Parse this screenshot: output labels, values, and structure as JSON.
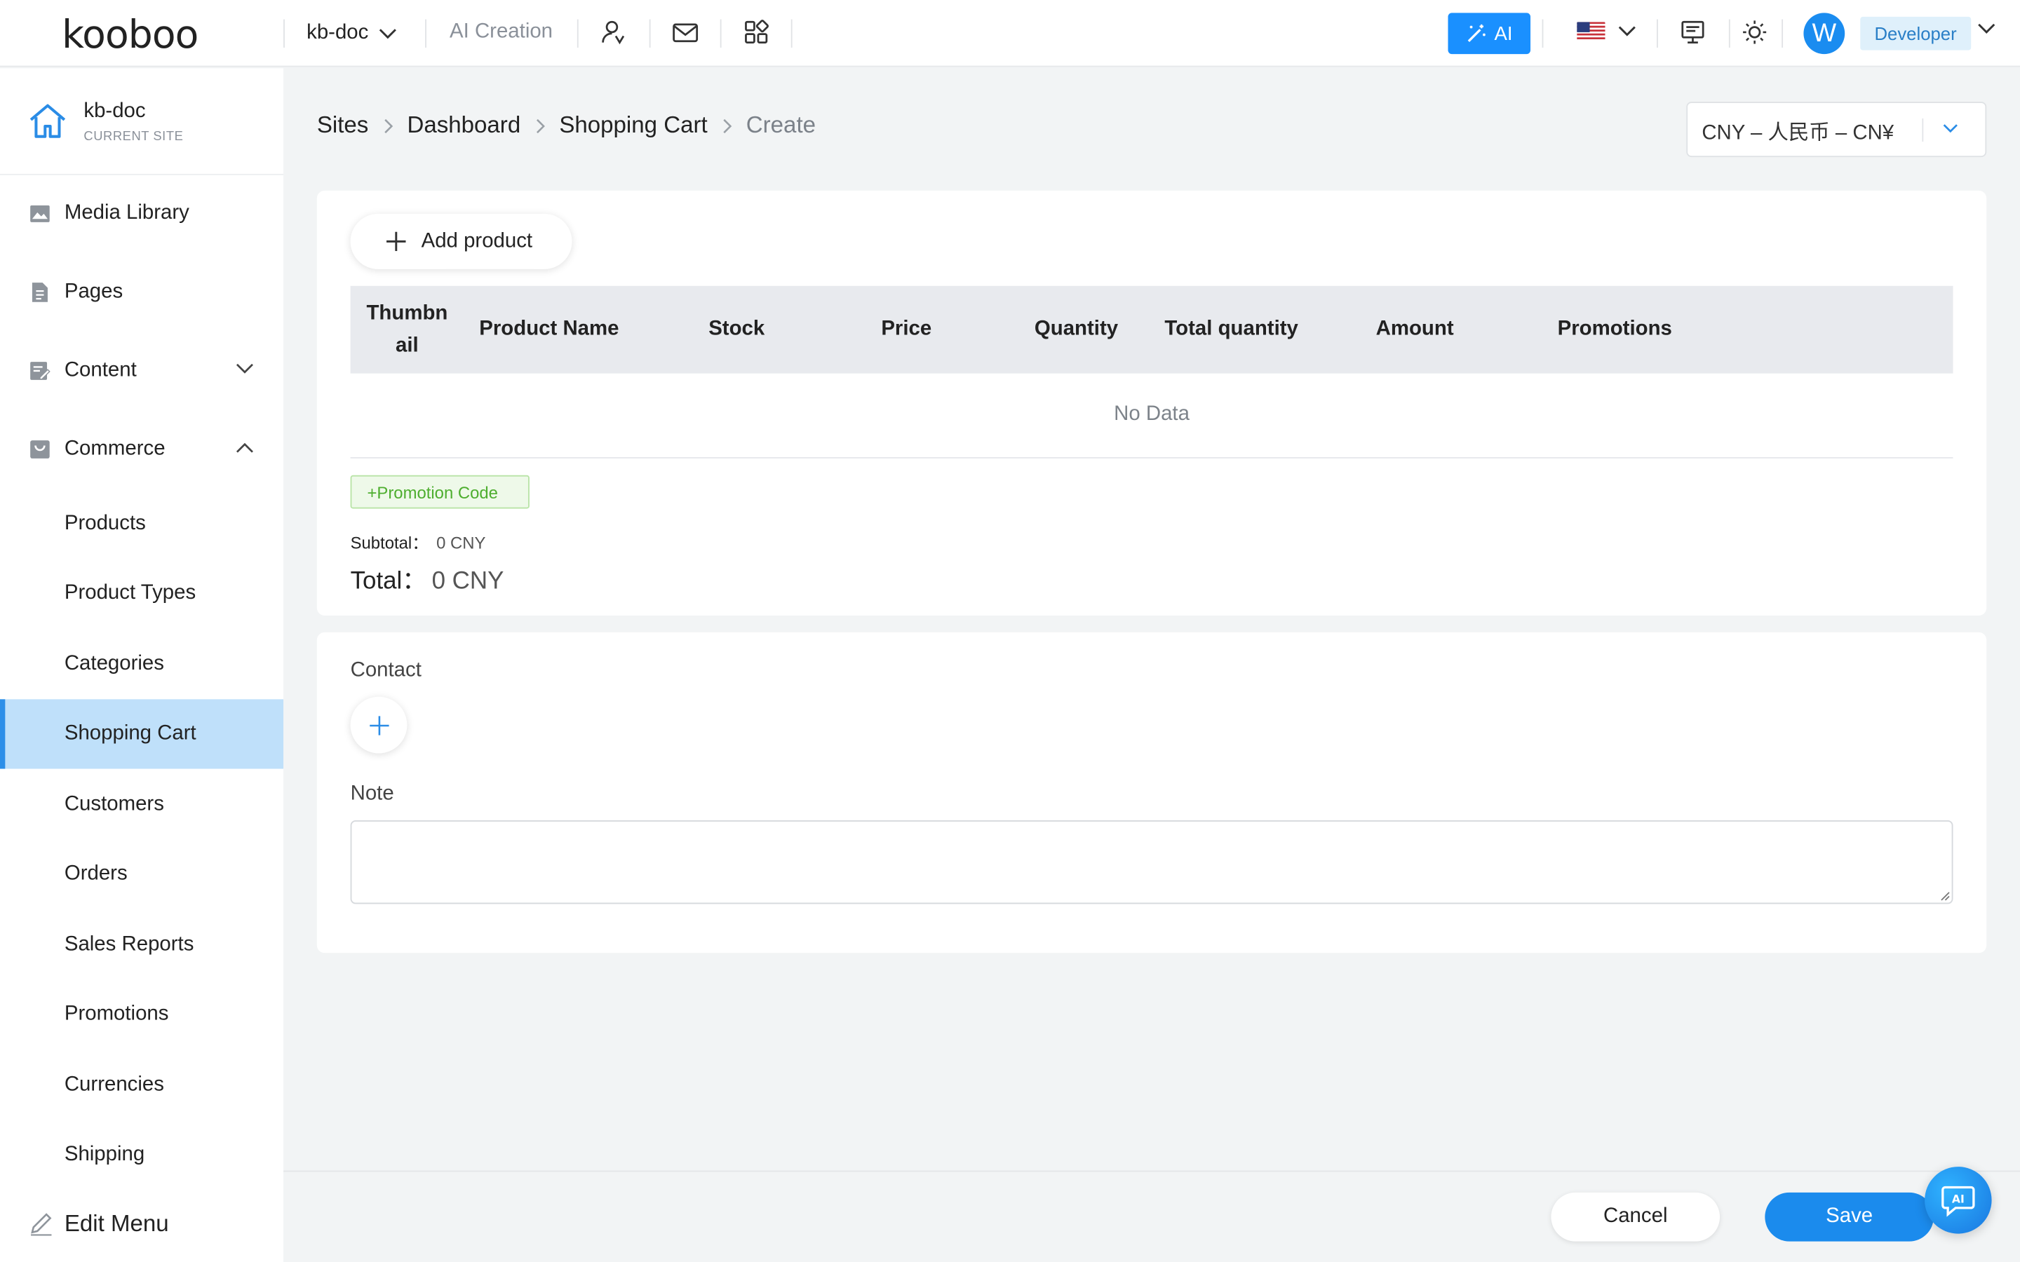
{
  "app": {
    "brand": "kooboo"
  },
  "topbar": {
    "site": "kb-doc",
    "ai_creation": "AI Creation",
    "ai_button": "AI",
    "user_initial": "W",
    "role": "Developer"
  },
  "sidebar": {
    "site_name": "kb-doc",
    "site_sub": "CURRENT SITE",
    "items": [
      {
        "label": "Media Library",
        "icon": "image-icon"
      },
      {
        "label": "Pages",
        "icon": "page-icon"
      },
      {
        "label": "Content",
        "icon": "edit-doc-icon",
        "expanded": false
      },
      {
        "label": "Commerce",
        "icon": "bag-icon",
        "expanded": true
      }
    ],
    "commerce_items": [
      {
        "label": "Products"
      },
      {
        "label": "Product Types"
      },
      {
        "label": "Categories"
      },
      {
        "label": "Shopping Cart",
        "active": true
      },
      {
        "label": "Customers"
      },
      {
        "label": "Orders"
      },
      {
        "label": "Sales Reports"
      },
      {
        "label": "Promotions"
      },
      {
        "label": "Currencies"
      },
      {
        "label": "Shipping"
      }
    ],
    "edit_menu": "Edit Menu"
  },
  "breadcrumb": [
    "Sites",
    "Dashboard",
    "Shopping Cart",
    "Create"
  ],
  "currency": {
    "selected": "CNY – 人民币 – CN¥"
  },
  "cart": {
    "add_product": "Add product",
    "columns": [
      "Thumbnail",
      "Product Name",
      "Stock",
      "Price",
      "Quantity",
      "Total quantity",
      "Amount",
      "Promotions"
    ],
    "thumb_line1": "Thumbn",
    "thumb_line2": "ail",
    "empty_text": "No Data",
    "promo_code": "+Promotion Code",
    "subtotal_label": "Subtotal：",
    "subtotal_value": "0 CNY",
    "total_label": "Total：",
    "total_value": "0 CNY"
  },
  "form": {
    "contact_label": "Contact",
    "note_label": "Note",
    "note_value": ""
  },
  "footer": {
    "cancel": "Cancel",
    "save": "Save"
  },
  "colors": {
    "accent": "#1b8bed",
    "active_bg": "#bfe0fa",
    "promo_green": "#4eae2f",
    "role_badge_bg": "#dff0fb"
  }
}
